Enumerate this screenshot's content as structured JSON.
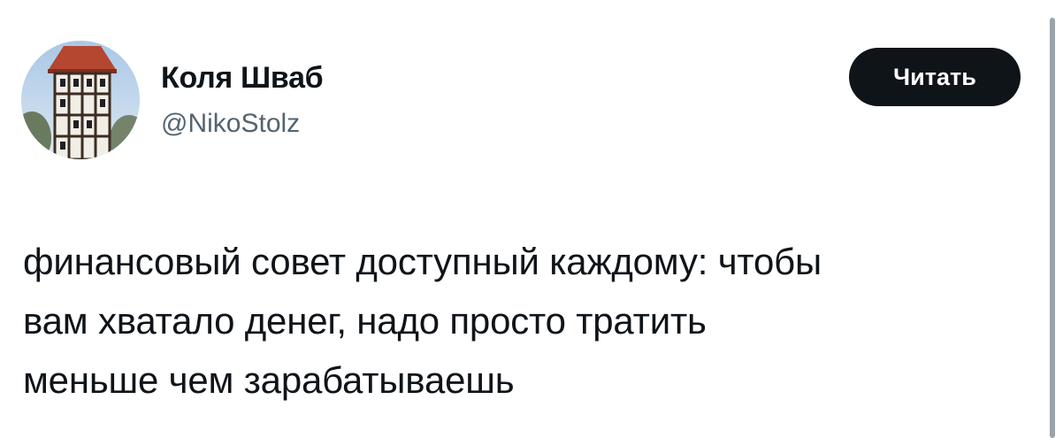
{
  "author": {
    "name": "Коля Шваб",
    "handle": "@NikoStolz",
    "avatar_icon": "half-timbered-tower-avatar"
  },
  "follow_button": {
    "label": "Читать"
  },
  "tweet": {
    "text": "финансовый совет доступный каждому: чтобы\nвам хватало денег, надо просто тратить\nменьше чем зарабатываешь"
  },
  "colors": {
    "text": "#0f1419",
    "secondary_text": "#536471",
    "button_bg": "#0f1419",
    "button_text": "#ffffff"
  }
}
